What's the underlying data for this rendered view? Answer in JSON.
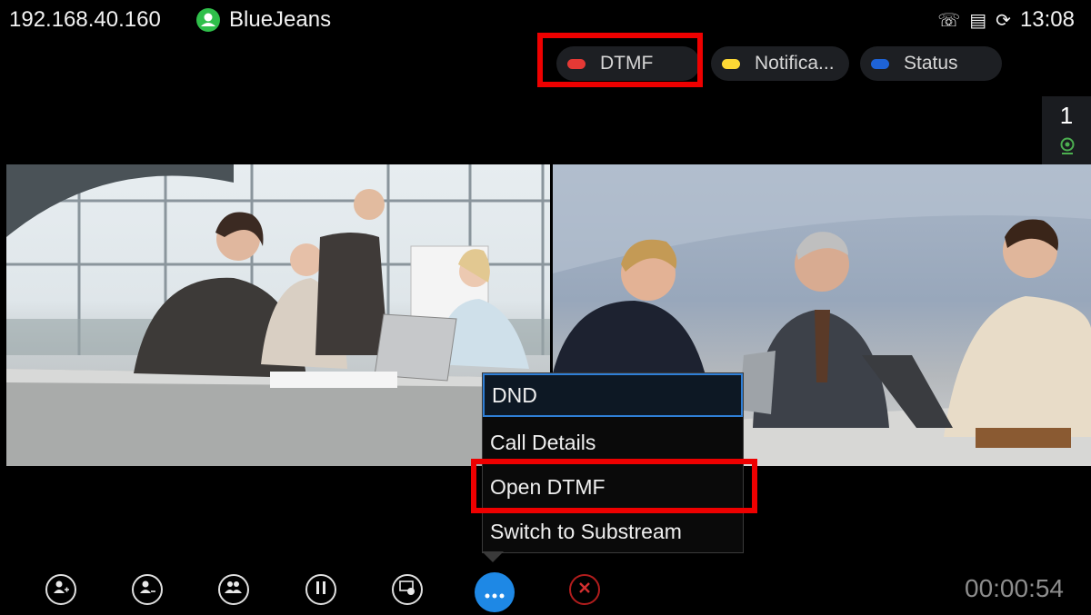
{
  "status_bar": {
    "ip": "192.168.40.160",
    "account": "BlueJeans",
    "time": "13:08",
    "icons": [
      "phone-call-icon",
      "phonebook-icon",
      "sync-icon"
    ]
  },
  "tabs": [
    {
      "label": "DTMF",
      "color": "#e53935"
    },
    {
      "label": "Notifica...",
      "color": "#fdd835"
    },
    {
      "label": "Status",
      "color": "#1e63d6"
    }
  ],
  "side_indicator": {
    "count": "1",
    "icon": "camera-icon"
  },
  "menu": {
    "items": [
      "DND",
      "Call Details",
      "Open DTMF",
      "Switch to Substream"
    ],
    "selected": "DND"
  },
  "controls": [
    {
      "icon": "add-participant-icon",
      "label": "+"
    },
    {
      "icon": "remove-participant-icon",
      "label": "–"
    },
    {
      "icon": "conference-icon",
      "label": ""
    },
    {
      "icon": "pause-icon",
      "label": "II"
    },
    {
      "icon": "present-icon",
      "label": ""
    },
    {
      "icon": "more-icon",
      "label": "•••"
    },
    {
      "icon": "end-call-icon",
      "label": "✕"
    }
  ],
  "timer": "00:00:54",
  "highlight_color": "#ee0000"
}
